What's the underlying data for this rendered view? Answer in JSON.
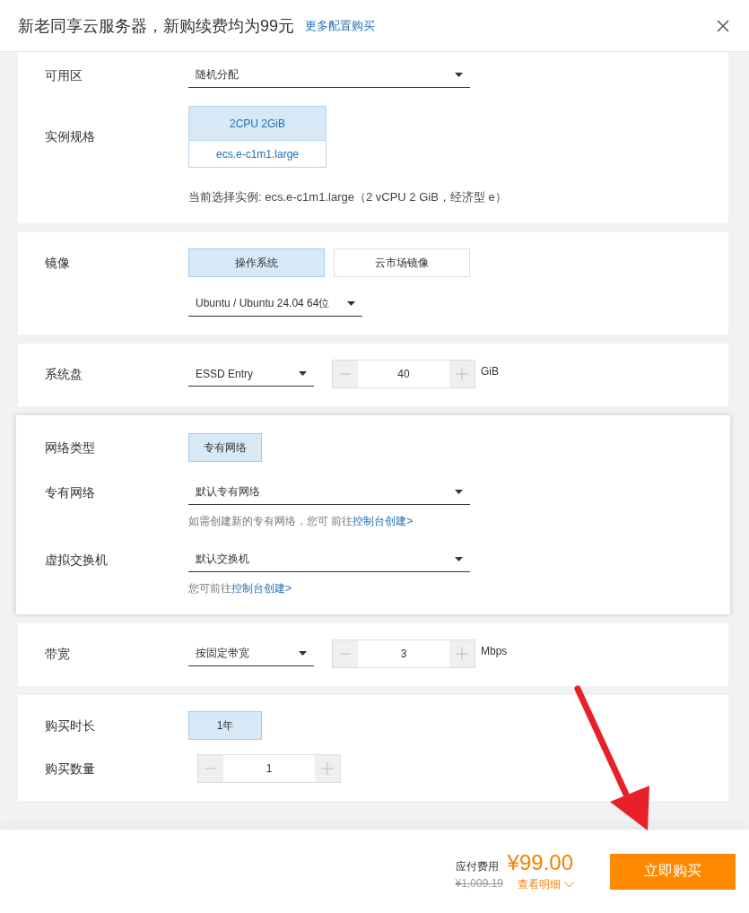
{
  "header": {
    "title": "新老同享云服务器，新购续费均为99元",
    "link": "更多配置购买"
  },
  "sections": [
    {
      "raised": false,
      "rows": [
        {
          "label": "可用区",
          "controls": [
            {
              "kind": "dropdown",
              "value": "随机分配"
            }
          ]
        },
        {
          "label": "实例规格",
          "controls": [
            {
              "kind": "spec",
              "title": "2CPU 2GiB",
              "subtitle": "ecs.e-c1m1.large",
              "selected": true
            }
          ]
        },
        {
          "controls": [
            {
              "kind": "note",
              "text": "当前选择实例: ecs.e-c1m1.large（2 vCPU 2 GiB，经济型 e）"
            }
          ]
        }
      ]
    },
    {
      "raised": false,
      "rows": [
        {
          "label": "镜像",
          "controls": [
            {
              "kind": "options",
              "options": [
                {
                  "label": "操作系统",
                  "selected": true
                },
                {
                  "label": "云市场镜像",
                  "selected": false
                }
              ]
            }
          ]
        },
        {
          "controls": [
            {
              "kind": "compact_dropdown",
              "value": "Ubuntu / Ubuntu 24.04 64位"
            }
          ]
        }
      ]
    },
    {
      "raised": false,
      "rows": [
        {
          "label": "系统盘",
          "controls": [
            {
              "kind": "compact_dropdown",
              "value": "ESSD Entry"
            },
            {
              "kind": "stepper",
              "value": "40",
              "unit": "GiB"
            }
          ]
        }
      ]
    },
    {
      "raised": true,
      "rows": [
        {
          "label": "网络类型",
          "controls": [
            {
              "kind": "options",
              "options": [
                {
                  "label": "专有网络",
                  "selected": true
                }
              ]
            }
          ]
        },
        {
          "label": "专有网络",
          "controls": [
            {
              "kind": "dropdown",
              "value": "默认专有网络"
            }
          ]
        },
        {
          "controls": [
            {
              "kind": "hint",
              "text": "如需创建新的专有网络，您可 前往",
              "link": "控制台创建>"
            }
          ]
        },
        {
          "label": "虚拟交换机",
          "controls": [
            {
              "kind": "dropdown",
              "value": "默认交换机"
            }
          ]
        },
        {
          "controls": [
            {
              "kind": "hint",
              "text": "您可前往",
              "link": "控制台创建>"
            }
          ]
        }
      ]
    },
    {
      "raised": false,
      "rows": [
        {
          "label": "带宽",
          "controls": [
            {
              "kind": "compact_dropdown",
              "value": "按固定带宽"
            },
            {
              "kind": "stepper",
              "value": "3",
              "unit": "Mbps"
            }
          ]
        }
      ]
    },
    {
      "raised": false,
      "rows": [
        {
          "label": "购买时长",
          "controls": [
            {
              "kind": "options",
              "options": [
                {
                  "label": "1年",
                  "selected": true
                }
              ]
            }
          ]
        },
        {
          "label": "购买数量",
          "controls": [
            {
              "kind": "stepper",
              "value": "1"
            }
          ]
        }
      ]
    }
  ],
  "footer": {
    "price_label": "应付费用",
    "price": "¥99.00",
    "original_price": "¥1,009.19",
    "details_link": "查看明细",
    "buy_button": "立即购买"
  }
}
